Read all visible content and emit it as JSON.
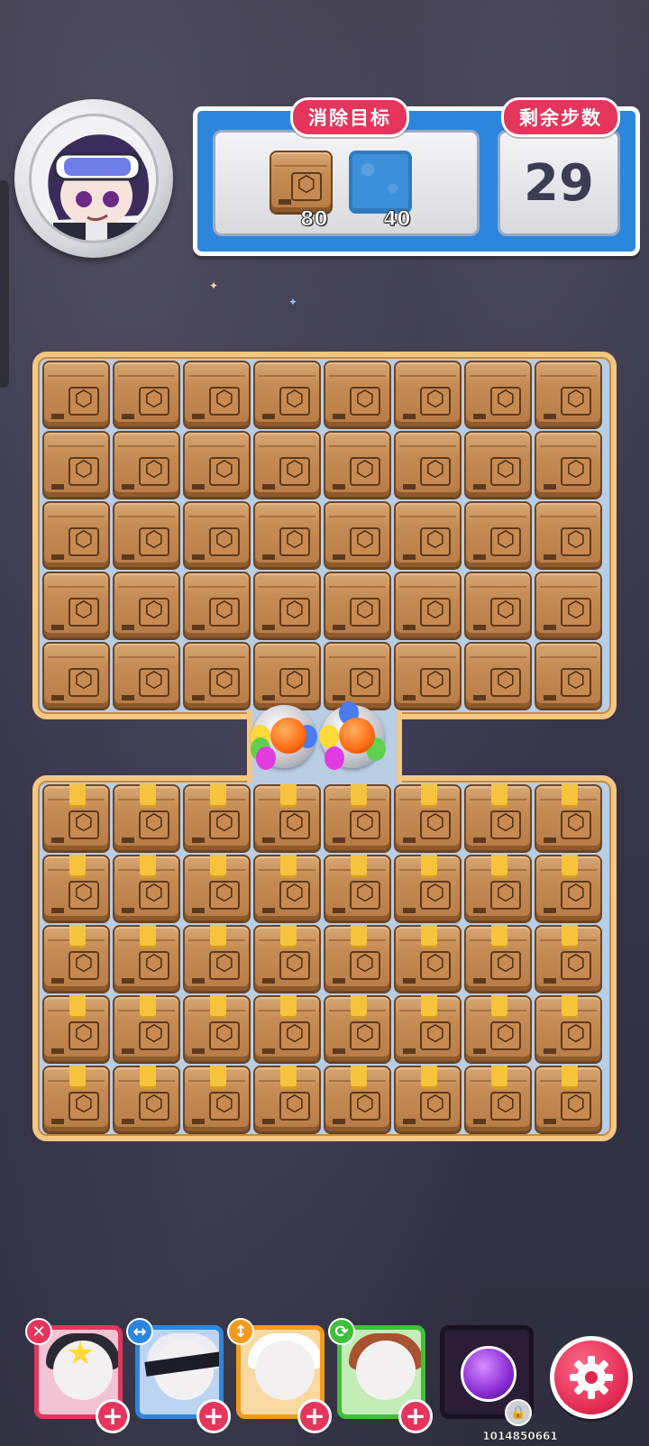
{
  "hud": {
    "goal_label": "消除目标",
    "moves_label": "剩余步数",
    "moves_remaining": "29",
    "goals": [
      {
        "icon": "cardboard-box-icon",
        "count": "80"
      },
      {
        "icon": "blue-stone-tile-icon",
        "count": "40"
      }
    ]
  },
  "board": {
    "top": {
      "rows": 5,
      "cols": 8,
      "tile": "cardboard-box"
    },
    "bottom": {
      "rows": 5,
      "cols": 8,
      "tile": "taped-cardboard-box"
    },
    "specials": [
      "rocket-orb",
      "rocket-orb"
    ]
  },
  "boosters": [
    {
      "name": "hero-card-1",
      "ability_icon": "cross-blast-icon",
      "border": "#e5355c"
    },
    {
      "name": "hero-card-2",
      "ability_icon": "horizontal-arrow-icon",
      "border": "#2d86dd"
    },
    {
      "name": "hero-card-3",
      "ability_icon": "vertical-arrow-icon",
      "border": "#f29b1c"
    },
    {
      "name": "hero-card-4",
      "ability_icon": "swap-icon",
      "border": "#3fbf3a"
    }
  ],
  "player_id": "1014850661",
  "colors": {
    "accent": "#e5355c",
    "panel_blue": "#2d86dd",
    "board_border": "#f6c780",
    "box": "#c68c55"
  }
}
